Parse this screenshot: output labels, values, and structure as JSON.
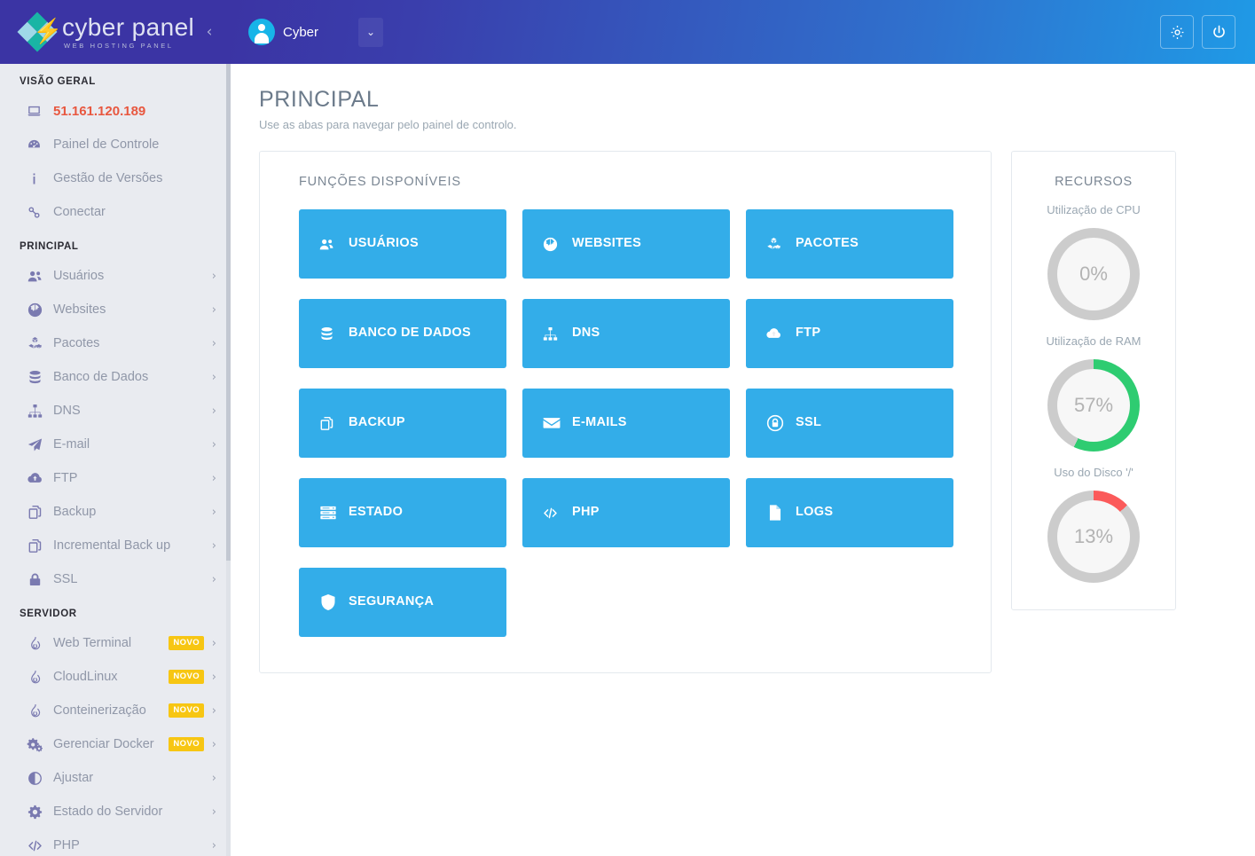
{
  "brand": {
    "name": "cyber panel",
    "tagline": "WEB HOSTING PANEL",
    "bolt_glyph": "⚡",
    "collapse_glyph": "‹"
  },
  "topbar": {
    "user_name": "Cyber",
    "dropdown_glyph": "⌄",
    "settings_icon": "gear-icon",
    "power_icon": "power-icon"
  },
  "page": {
    "title": "PRINCIPAL",
    "subtitle": "Use as abas para navegar pelo painel de controlo."
  },
  "sidebar": {
    "groups": [
      {
        "heading": "VISÃO GERAL",
        "items": [
          {
            "label": "51.161.120.189",
            "icon": "laptop-icon",
            "caret": "",
            "badge": "",
            "highlight": true
          },
          {
            "label": "Painel de Controle",
            "icon": "dashboard-icon",
            "caret": "",
            "badge": ""
          },
          {
            "label": "Gestão de Versões",
            "icon": "info-icon",
            "caret": "",
            "badge": ""
          },
          {
            "label": "Conectar",
            "icon": "link-icon",
            "caret": "",
            "badge": ""
          }
        ]
      },
      {
        "heading": "PRINCIPAL",
        "items": [
          {
            "label": "Usuários",
            "icon": "users-icon",
            "caret": "›",
            "badge": ""
          },
          {
            "label": "Websites",
            "icon": "globe-icon",
            "caret": "›",
            "badge": ""
          },
          {
            "label": "Pacotes",
            "icon": "packages-icon",
            "caret": "›",
            "badge": ""
          },
          {
            "label": "Banco de Dados",
            "icon": "database-icon",
            "caret": "›",
            "badge": ""
          },
          {
            "label": "DNS",
            "icon": "sitemap-icon",
            "caret": "›",
            "badge": ""
          },
          {
            "label": "E-mail",
            "icon": "paper-plane-icon",
            "caret": "›",
            "badge": ""
          },
          {
            "label": "FTP",
            "icon": "cloud-upload-icon",
            "caret": "›",
            "badge": ""
          },
          {
            "label": "Backup",
            "icon": "copy-icon",
            "caret": "›",
            "badge": ""
          },
          {
            "label": "Incremental Back up",
            "icon": "copy-icon",
            "caret": "›",
            "badge": ""
          },
          {
            "label": "SSL",
            "icon": "lock-icon",
            "caret": "›",
            "badge": ""
          }
        ]
      },
      {
        "heading": "SERVIDOR",
        "items": [
          {
            "label": "Web Terminal",
            "icon": "fire-icon",
            "caret": "›",
            "badge": "NOVO"
          },
          {
            "label": "CloudLinux",
            "icon": "fire-icon",
            "caret": "›",
            "badge": "NOVO"
          },
          {
            "label": "Conteinerização",
            "icon": "fire-icon",
            "caret": "›",
            "badge": "NOVO"
          },
          {
            "label": "Gerenciar Docker",
            "icon": "cogs-icon",
            "caret": "›",
            "badge": "NOVO"
          },
          {
            "label": "Ajustar",
            "icon": "adjust-icon",
            "caret": "›",
            "badge": ""
          },
          {
            "label": "Estado do Servidor",
            "icon": "gear-icon",
            "caret": "›",
            "badge": ""
          },
          {
            "label": "PHP",
            "icon": "code-icon",
            "caret": "›",
            "badge": ""
          }
        ]
      }
    ]
  },
  "functions": {
    "title": "FUNÇÕES DISPONÍVEIS",
    "tile_color": "#33ade9",
    "tiles": [
      {
        "label": "USUÁRIOS",
        "icon": "users-icon"
      },
      {
        "label": "WEBSITES",
        "icon": "globe-icon"
      },
      {
        "label": "PACOTES",
        "icon": "packages-icon"
      },
      {
        "label": "BANCO DE DADOS",
        "icon": "database-icon"
      },
      {
        "label": "DNS",
        "icon": "sitemap-icon"
      },
      {
        "label": "FTP",
        "icon": "cloud-upload-icon"
      },
      {
        "label": "BACKUP",
        "icon": "copy-icon"
      },
      {
        "label": "E-MAILS",
        "icon": "envelope-icon"
      },
      {
        "label": "SSL",
        "icon": "lock-circle-icon"
      },
      {
        "label": "ESTADO",
        "icon": "server-icon"
      },
      {
        "label": "PHP",
        "icon": "code-icon"
      },
      {
        "label": "LOGS",
        "icon": "file-icon"
      },
      {
        "label": "SEGURANÇA",
        "icon": "shield-icon"
      }
    ]
  },
  "resources": {
    "title": "RECURSOS",
    "gauges": [
      {
        "caption": "Utilização de CPU",
        "value": "0%",
        "percent": 0,
        "color": "#cccccc",
        "track": "#cccccc"
      },
      {
        "caption": "Utilização de RAM",
        "value": "57%",
        "percent": 57,
        "color": "#2ecc71",
        "track": "#cccccc"
      },
      {
        "caption": "Uso do Disco '/'",
        "value": "13%",
        "percent": 13,
        "color": "#fb5a5a",
        "track": "#cccccc"
      }
    ]
  }
}
